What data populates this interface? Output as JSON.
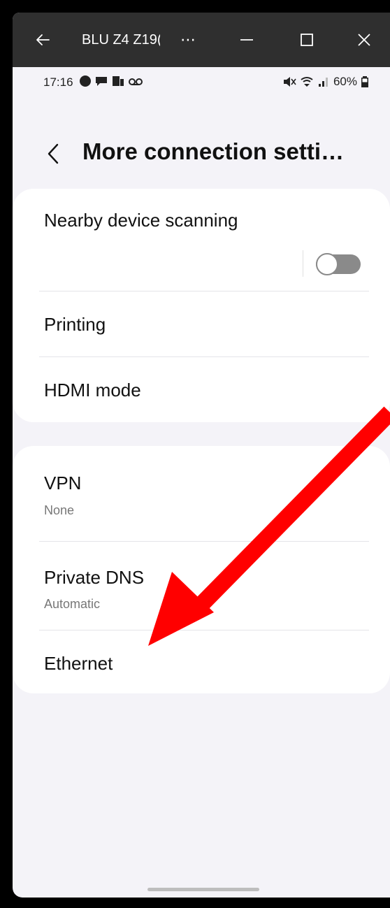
{
  "window": {
    "title": "BLU Z4 Z19(",
    "more_label": "⋯"
  },
  "status_bar": {
    "time": "17:16",
    "battery": "60%"
  },
  "header": {
    "title": "More connection setti…"
  },
  "group1": {
    "nearby_scanning": {
      "label": "Nearby device scanning",
      "toggle_state": "off"
    },
    "printing": {
      "label": "Printing"
    },
    "hdmi": {
      "label": "HDMI mode"
    }
  },
  "group2": {
    "vpn": {
      "label": "VPN",
      "summary": "None"
    },
    "private_dns": {
      "label": "Private DNS",
      "summary": "Automatic"
    },
    "ethernet": {
      "label": "Ethernet"
    }
  },
  "annotation": {
    "arrow_color": "#ff0000",
    "points_to": "Ethernet"
  },
  "colors": {
    "background": "#f4f3f8",
    "card": "#ffffff",
    "titlebar": "#2f2f2f"
  }
}
